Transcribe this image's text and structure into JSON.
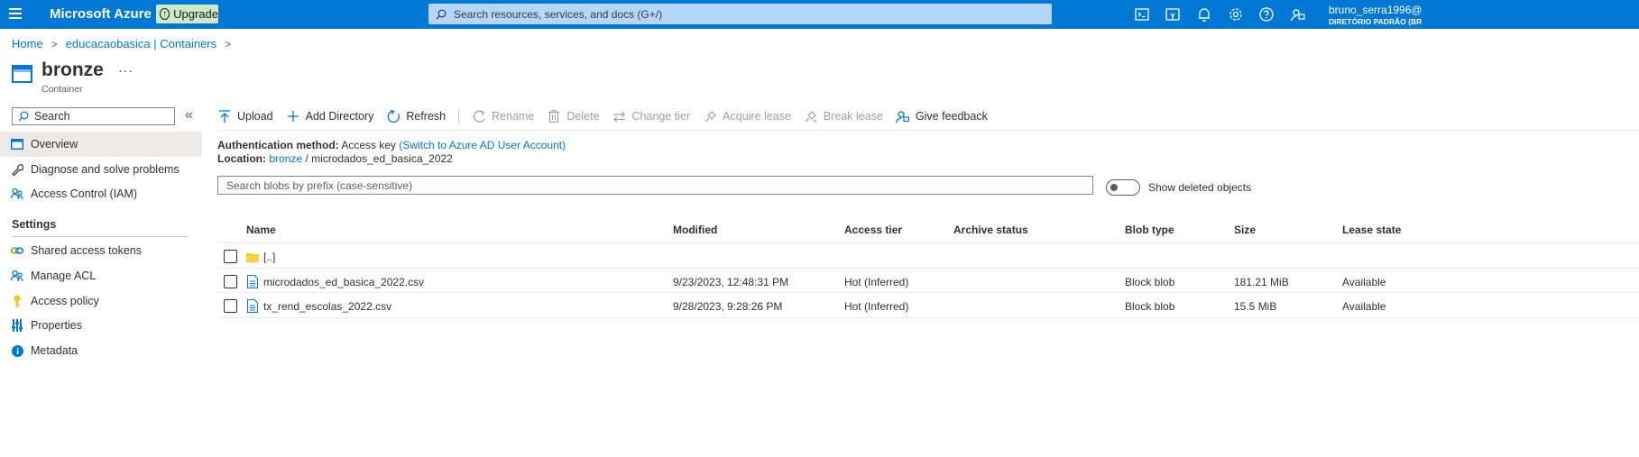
{
  "topbar": {
    "brand": "Microsoft Azure",
    "upgrade_label": "Upgrade",
    "search_placeholder": "Search resources, services, and docs (G+/)",
    "user_name": "bruno_serra1996@",
    "user_directory": "DIRETÓRIO PADRÃO (BR",
    "icons": [
      "cloud-shell-icon",
      "directory-filter-icon",
      "notifications-icon",
      "settings-icon",
      "help-icon",
      "feedback-icon"
    ]
  },
  "breadcrumb": {
    "items": [
      "Home",
      "educacaobasica | Containers"
    ],
    "separator": ">"
  },
  "header": {
    "title": "bronze",
    "subtitle": "Container",
    "more_label": "···"
  },
  "sidebar": {
    "search_placeholder": "Search",
    "collapse_label": "«",
    "items": [
      {
        "label": "Overview",
        "icon": "overview-icon",
        "active": true
      },
      {
        "label": "Diagnose and solve problems",
        "icon": "wrench-icon"
      },
      {
        "label": "Access Control (IAM)",
        "icon": "people-icon"
      }
    ],
    "settings_heading": "Settings",
    "settings_items": [
      {
        "label": "Shared access tokens",
        "icon": "link-icon"
      },
      {
        "label": "Manage ACL",
        "icon": "people-icon"
      },
      {
        "label": "Access policy",
        "icon": "key-icon"
      },
      {
        "label": "Properties",
        "icon": "properties-icon"
      },
      {
        "label": "Metadata",
        "icon": "info-icon"
      }
    ]
  },
  "toolbar": {
    "upload": "Upload",
    "add_directory": "Add Directory",
    "refresh": "Refresh",
    "rename": "Rename",
    "delete": "Delete",
    "change_tier": "Change tier",
    "acquire_lease": "Acquire lease",
    "break_lease": "Break lease",
    "give_feedback": "Give feedback"
  },
  "info": {
    "auth_label": "Authentication method:",
    "auth_value": "Access key",
    "auth_link": "(Switch to Azure AD User Account)",
    "location_label": "Location:",
    "location_link": "bronze",
    "location_sep": "/",
    "location_path": "microdados_ed_basica_2022"
  },
  "blob_search": {
    "placeholder": "Search blobs by prefix (case-sensitive)"
  },
  "show_deleted": {
    "label": "Show deleted objects",
    "on": false
  },
  "table": {
    "columns": [
      "Name",
      "Modified",
      "Access tier",
      "Archive status",
      "Blob type",
      "Size",
      "Lease state"
    ],
    "rows": [
      {
        "name": "[..]",
        "type": "folder",
        "modified": "",
        "access_tier": "",
        "archive_status": "",
        "blob_type": "",
        "size": "",
        "lease_state": ""
      },
      {
        "name": "microdados_ed_basica_2022.csv",
        "type": "file",
        "modified": "9/23/2023, 12:48:31 PM",
        "access_tier": "Hot (Inferred)",
        "archive_status": "",
        "blob_type": "Block blob",
        "size": "181.21 MiB",
        "lease_state": "Available"
      },
      {
        "name": "tx_rend_escolas_2022.csv",
        "type": "file",
        "modified": "9/28/2023, 9:28:26 PM",
        "access_tier": "Hot (Inferred)",
        "archive_status": "",
        "blob_type": "Block blob",
        "size": "15.5 MiB",
        "lease_state": "Available"
      }
    ]
  },
  "colors": {
    "topbar": "#0078d4",
    "link": "#0078d4",
    "upgrade_bg": "#cfe8c8",
    "search_bg": "#b4d6fa",
    "folder": "#f2c811"
  }
}
